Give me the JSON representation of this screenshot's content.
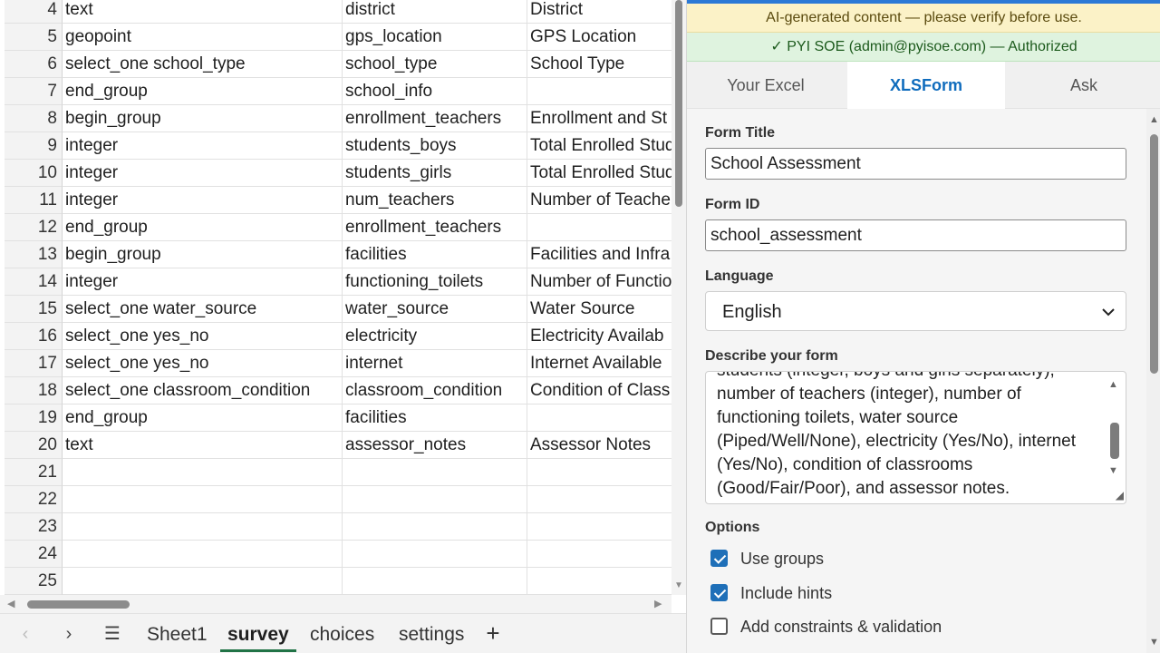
{
  "sheet": {
    "rows": [
      {
        "num": "4",
        "a": "text",
        "b": "district",
        "c": "District"
      },
      {
        "num": "5",
        "a": "geopoint",
        "b": "gps_location",
        "c": "GPS Location"
      },
      {
        "num": "6",
        "a": "select_one school_type",
        "b": "school_type",
        "c": "School Type"
      },
      {
        "num": "7",
        "a": "end_group",
        "b": "school_info",
        "c": ""
      },
      {
        "num": "8",
        "a": "begin_group",
        "b": "enrollment_teachers",
        "c": "Enrollment and St"
      },
      {
        "num": "9",
        "a": "integer",
        "b": "students_boys",
        "c": "Total Enrolled Stud"
      },
      {
        "num": "10",
        "a": "integer",
        "b": "students_girls",
        "c": "Total Enrolled Stud"
      },
      {
        "num": "11",
        "a": "integer",
        "b": "num_teachers",
        "c": "Number of Teache"
      },
      {
        "num": "12",
        "a": "end_group",
        "b": "enrollment_teachers",
        "c": ""
      },
      {
        "num": "13",
        "a": "begin_group",
        "b": "facilities",
        "c": "Facilities and Infra"
      },
      {
        "num": "14",
        "a": "integer",
        "b": "functioning_toilets",
        "c": "Number of Functio"
      },
      {
        "num": "15",
        "a": "select_one water_source",
        "b": "water_source",
        "c": "Water Source"
      },
      {
        "num": "16",
        "a": "select_one yes_no",
        "b": "electricity",
        "c": "Electricity Availab"
      },
      {
        "num": "17",
        "a": "select_one yes_no",
        "b": "internet",
        "c": "Internet Available"
      },
      {
        "num": "18",
        "a": "select_one classroom_condition",
        "b": "classroom_condition",
        "c": "Condition of Class"
      },
      {
        "num": "19",
        "a": "end_group",
        "b": "facilities",
        "c": ""
      },
      {
        "num": "20",
        "a": "text",
        "b": "assessor_notes",
        "c": "Assessor Notes"
      },
      {
        "num": "21",
        "a": "",
        "b": "",
        "c": ""
      },
      {
        "num": "22",
        "a": "",
        "b": "",
        "c": ""
      },
      {
        "num": "23",
        "a": "",
        "b": "",
        "c": ""
      },
      {
        "num": "24",
        "a": "",
        "b": "",
        "c": ""
      },
      {
        "num": "25",
        "a": "",
        "b": "",
        "c": ""
      }
    ],
    "tabs": {
      "sheet1": "Sheet1",
      "survey": "survey",
      "choices": "choices",
      "settings": "settings",
      "active": "survey"
    },
    "icons": {
      "prev": "chevron-left-icon",
      "next": "chevron-right-icon",
      "all_sheets": "hamburger-menu-icon",
      "add": "plus-icon"
    }
  },
  "pane": {
    "ai_banner": "AI-generated content — please verify before use.",
    "auth_banner": "✓ PYI SOE (admin@pyisoe.com) — Authorized",
    "tabs": {
      "excel": "Your Excel",
      "xlsform": "XLSForm",
      "ask": "Ask",
      "active": "XLSForm"
    },
    "form": {
      "title_label": "Form Title",
      "title_value": "School Assessment",
      "id_label": "Form ID",
      "id_value": "school_assessment",
      "language_label": "Language",
      "language_value": "English",
      "describe_label": "Describe your form",
      "describe_lines": [
        "students (integer, boys and girls separately),",
        "number of teachers (integer), number of",
        "functioning toilets, water source",
        "(Piped/Well/None), electricity (Yes/No), internet",
        "(Yes/No), condition of classrooms",
        "(Good/Fair/Poor), and assessor notes."
      ],
      "options_label": "Options",
      "options": [
        {
          "label": "Use groups",
          "checked": true
        },
        {
          "label": "Include hints",
          "checked": true
        },
        {
          "label": "Add constraints & validation",
          "checked": false
        }
      ]
    },
    "colors": {
      "accent": "#0f6cbd",
      "ai_banner_bg": "#fbf2c7",
      "auth_banner_bg": "#dff3df",
      "checkbox_on": "#1e6fb8",
      "excel_green": "#217346"
    }
  }
}
